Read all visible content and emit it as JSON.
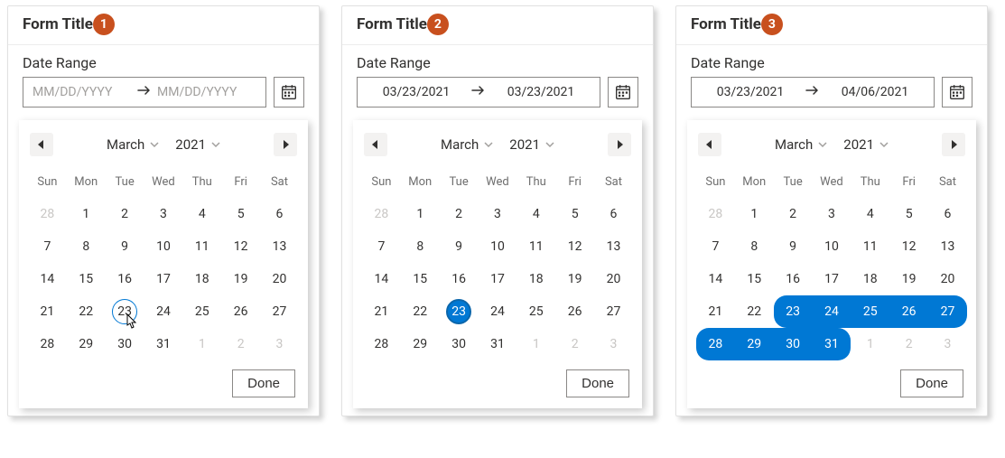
{
  "weekday_labels": [
    "Sun",
    "Mon",
    "Tue",
    "Wed",
    "Thu",
    "Fri",
    "Sat"
  ],
  "panels": [
    {
      "badge": "1",
      "title": "Form Title",
      "field_label": "Date Range",
      "start_value": "",
      "end_value": "",
      "start_placeholder": "MM/DD/YYYY",
      "end_placeholder": "MM/DD/YYYY",
      "month": "March",
      "year": "2021",
      "done_label": "Done",
      "days": [
        [
          {
            "d": 28,
            "out": true
          },
          {
            "d": 1
          },
          {
            "d": 2
          },
          {
            "d": 3
          },
          {
            "d": 4
          },
          {
            "d": 5
          },
          {
            "d": 6
          }
        ],
        [
          {
            "d": 7
          },
          {
            "d": 8
          },
          {
            "d": 9
          },
          {
            "d": 10
          },
          {
            "d": 11
          },
          {
            "d": 12
          },
          {
            "d": 13
          }
        ],
        [
          {
            "d": 14
          },
          {
            "d": 15
          },
          {
            "d": 16
          },
          {
            "d": 17
          },
          {
            "d": 18
          },
          {
            "d": 19
          },
          {
            "d": 20
          }
        ],
        [
          {
            "d": 21
          },
          {
            "d": 22
          },
          {
            "d": 23,
            "hover": true,
            "cursor": true
          },
          {
            "d": 24
          },
          {
            "d": 25
          },
          {
            "d": 26
          },
          {
            "d": 27
          }
        ],
        [
          {
            "d": 28
          },
          {
            "d": 29
          },
          {
            "d": 30
          },
          {
            "d": 31
          },
          {
            "d": 1,
            "out": true
          },
          {
            "d": 2,
            "out": true
          },
          {
            "d": 3,
            "out": true
          }
        ]
      ]
    },
    {
      "badge": "2",
      "title": "Form Title",
      "field_label": "Date Range",
      "start_value": "03/23/2021",
      "end_value": "03/23/2021",
      "start_placeholder": "MM/DD/YYYY",
      "end_placeholder": "MM/DD/YYYY",
      "month": "March",
      "year": "2021",
      "done_label": "Done",
      "days": [
        [
          {
            "d": 28,
            "out": true
          },
          {
            "d": 1
          },
          {
            "d": 2
          },
          {
            "d": 3
          },
          {
            "d": 4
          },
          {
            "d": 5
          },
          {
            "d": 6
          }
        ],
        [
          {
            "d": 7
          },
          {
            "d": 8
          },
          {
            "d": 9
          },
          {
            "d": 10
          },
          {
            "d": 11
          },
          {
            "d": 12
          },
          {
            "d": 13
          }
        ],
        [
          {
            "d": 14
          },
          {
            "d": 15
          },
          {
            "d": 16
          },
          {
            "d": 17
          },
          {
            "d": 18
          },
          {
            "d": 19
          },
          {
            "d": 20
          }
        ],
        [
          {
            "d": 21
          },
          {
            "d": 22
          },
          {
            "d": 23,
            "selstart": true,
            "selend": true
          },
          {
            "d": 24
          },
          {
            "d": 25
          },
          {
            "d": 26
          },
          {
            "d": 27
          }
        ],
        [
          {
            "d": 28
          },
          {
            "d": 29
          },
          {
            "d": 30
          },
          {
            "d": 31
          },
          {
            "d": 1,
            "out": true
          },
          {
            "d": 2,
            "out": true
          },
          {
            "d": 3,
            "out": true
          }
        ]
      ]
    },
    {
      "badge": "3",
      "title": "Form Title",
      "field_label": "Date Range",
      "start_value": "03/23/2021",
      "end_value": "04/06/2021",
      "start_placeholder": "MM/DD/YYYY",
      "end_placeholder": "MM/DD/YYYY",
      "month": "March",
      "year": "2021",
      "done_label": "Done",
      "days": [
        [
          {
            "d": 28,
            "out": true
          },
          {
            "d": 1
          },
          {
            "d": 2
          },
          {
            "d": 3
          },
          {
            "d": 4
          },
          {
            "d": 5
          },
          {
            "d": 6
          }
        ],
        [
          {
            "d": 7
          },
          {
            "d": 8
          },
          {
            "d": 9
          },
          {
            "d": 10
          },
          {
            "d": 11
          },
          {
            "d": 12
          },
          {
            "d": 13
          }
        ],
        [
          {
            "d": 14
          },
          {
            "d": 15
          },
          {
            "d": 16
          },
          {
            "d": 17
          },
          {
            "d": 18
          },
          {
            "d": 19
          },
          {
            "d": 20
          }
        ],
        [
          {
            "d": 21
          },
          {
            "d": 22
          },
          {
            "d": 23,
            "inrange": true,
            "range_left": true
          },
          {
            "d": 24,
            "inrange": true
          },
          {
            "d": 25,
            "inrange": true
          },
          {
            "d": 26,
            "inrange": true
          },
          {
            "d": 27,
            "inrange": true,
            "range_right": true
          }
        ],
        [
          {
            "d": 28,
            "inrange": true,
            "range_left": true
          },
          {
            "d": 29,
            "inrange": true
          },
          {
            "d": 30,
            "inrange": true
          },
          {
            "d": 31,
            "inrange": true,
            "range_right": true
          },
          {
            "d": 1,
            "out": true
          },
          {
            "d": 2,
            "out": true
          },
          {
            "d": 3,
            "out": true
          }
        ]
      ]
    }
  ]
}
